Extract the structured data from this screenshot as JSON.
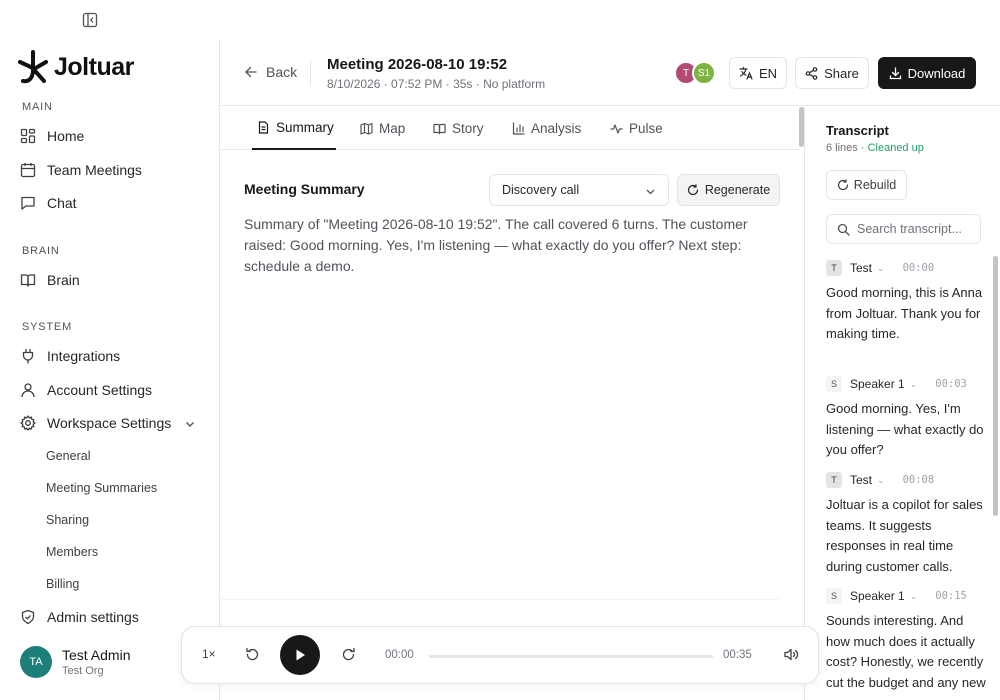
{
  "brand": {
    "name": "Joltuar"
  },
  "sidebar": {
    "sections": {
      "main": "MAIN",
      "brain": "BRAIN",
      "system": "SYSTEM"
    },
    "main_items": [
      {
        "label": "Home"
      },
      {
        "label": "Team Meetings"
      },
      {
        "label": "Chat"
      }
    ],
    "brain_items": [
      {
        "label": "Brain"
      }
    ],
    "system_items": [
      {
        "label": "Integrations"
      },
      {
        "label": "Account Settings"
      },
      {
        "label": "Workspace Settings"
      }
    ],
    "workspace_sub": [
      {
        "label": "General"
      },
      {
        "label": "Meeting Summaries"
      },
      {
        "label": "Sharing"
      },
      {
        "label": "Members"
      },
      {
        "label": "Billing"
      }
    ],
    "admin": {
      "label": "Admin settings"
    }
  },
  "user": {
    "initials": "TA",
    "name": "Test Admin",
    "org": "Test Org"
  },
  "header": {
    "back_label": "Back",
    "title": "Meeting 2026-08-10 19:52",
    "meta": "8/10/2026 · 07:52 PM · 35s · No platform",
    "participants": [
      {
        "initials": "T",
        "color": "#b24b73"
      },
      {
        "initials": "S1",
        "color": "#7cb342"
      }
    ],
    "language_label": "EN",
    "share_label": "Share",
    "download_label": "Download"
  },
  "tabs": [
    {
      "label": "Summary"
    },
    {
      "label": "Map"
    },
    {
      "label": "Story"
    },
    {
      "label": "Analysis"
    },
    {
      "label": "Pulse"
    }
  ],
  "summary": {
    "heading": "Meeting Summary",
    "template_value": "Discovery call",
    "regenerate_label": "Regenerate",
    "text": "Summary of \"Meeting 2026-08-10 19:52\". The call covered 6 turns. The customer raised: Good morning. Yes, I'm listening — what exactly do you offer? Next step: schedule a demo."
  },
  "transcript": {
    "title": "Transcript",
    "count": "6 lines",
    "status": "· Cleaned up",
    "rebuild_label": "Rebuild",
    "search_placeholder": "Search transcript...",
    "entries": [
      {
        "badge": "T",
        "speaker": "Test",
        "time": "00:00",
        "text": "Good morning, this is Anna from Joltuar. Thank you for making time."
      },
      {
        "badge": "S",
        "speaker": "Speaker 1",
        "time": "00:03",
        "text": "Good morning. Yes, I'm listening — what exactly do you offer?"
      },
      {
        "badge": "T",
        "speaker": "Test",
        "time": "00:08",
        "text": "Joltuar is a copilot for sales teams. It suggests responses in real time during customer calls."
      },
      {
        "badge": "S",
        "speaker": "Speaker 1",
        "time": "00:15",
        "text": "Sounds interesting. And how much does it actually cost? Honestly, we recently cut the budget and any new"
      }
    ]
  },
  "player": {
    "speed": "1×",
    "current_time": "00:00",
    "duration": "00:35",
    "progress": 0
  },
  "colors": {
    "accent": "#18181b",
    "status_green": "#22a06b",
    "avatar_teal": "#1e7f7a"
  }
}
